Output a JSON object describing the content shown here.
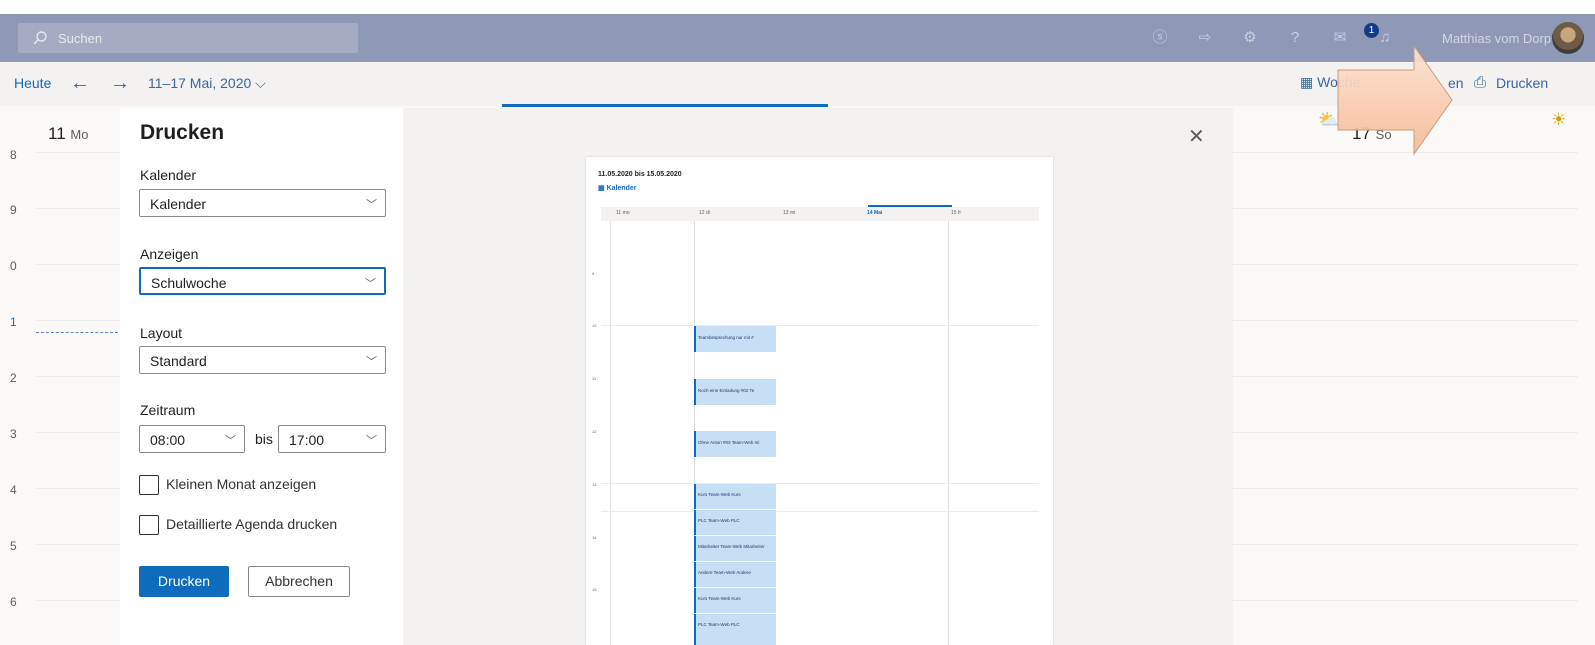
{
  "topbar": {
    "search_placeholder": "Suchen",
    "notification_count": "1",
    "user_name": "Matthias vom Dorp"
  },
  "navbar": {
    "today": "Heute",
    "date_range": "11–17 Mai, 2020",
    "view_label": "Woche",
    "partial_label": "en",
    "print_label": "Drucken"
  },
  "calendar": {
    "day_first": {
      "num": "11",
      "name": "Mo"
    },
    "day_last": {
      "num": "17",
      "name": "So"
    },
    "hours": [
      "8",
      "9",
      "0",
      "1",
      "2",
      "3",
      "4",
      "5",
      "6"
    ]
  },
  "dialog": {
    "title": "Drucken",
    "kalender_label": "Kalender",
    "kalender_value": "Kalender",
    "anzeigen_label": "Anzeigen",
    "anzeigen_value": "Schulwoche",
    "layout_label": "Layout",
    "layout_value": "Standard",
    "zeitraum_label": "Zeitraum",
    "start_time": "08:00",
    "bis_label": "bis",
    "end_time": "17:00",
    "small_month_label": "Kleinen Monat anzeigen",
    "detailed_agenda_label": "Detaillierte Agenda drucken",
    "print_button": "Drucken",
    "cancel_button": "Abbrechen"
  },
  "preview": {
    "title": "11.05.2020 bis 15.05.2020",
    "calendar_name": "Kalender",
    "columns": [
      "11 mo",
      "12 di",
      "13 mi",
      "14 Mai",
      "15 fr"
    ],
    "hours": [
      "9",
      "10",
      "11",
      "12",
      "13",
      "14",
      "15"
    ],
    "events": [
      "Teambesprechung nur mit #",
      "Noch eine Einladung #02 Te",
      "Ohne Anton #03 Team-Web mi",
      "Kurs Team-Web Kurs",
      "PLC Team-Web PLC",
      "Mitarbeiter Team-Web Mitarbeiter",
      "Andere Team-Web Andere",
      "Kurs Team-Web Kurs",
      "PLC Team-Web PLC"
    ]
  },
  "colors": {
    "accent": "#0f6cbd",
    "topbar": "#8f98b6",
    "callout": "#f8c9a8"
  }
}
